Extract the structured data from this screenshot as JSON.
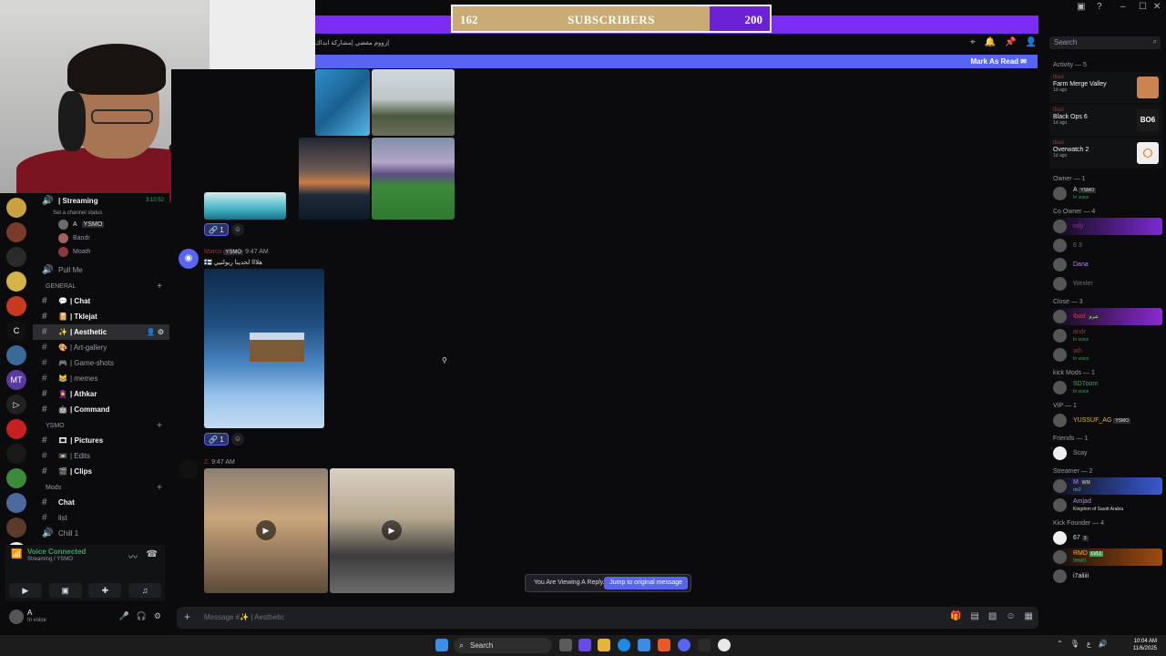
{
  "window": {
    "minimize": "–",
    "maximize": "☐",
    "close": "✕",
    "help": "?"
  },
  "counter": {
    "current": "162",
    "label": "SUBSCRIBERS",
    "goal": "200",
    "progress": 0.81
  },
  "channel_header": {
    "title": "زووم مفضي |مشاركة ايداك|"
  },
  "search": {
    "placeholder": "Search"
  },
  "mark_as_read": {
    "label": "Mark As Read"
  },
  "sidebar": {
    "streaming_title": "| Streaming",
    "streaming_time": "3:10:52",
    "set_status": "Set a channel status",
    "voice_users": [
      {
        "name": "A",
        "tag": "YSMO"
      },
      {
        "name": "Bandr"
      },
      {
        "name": "Moath"
      }
    ],
    "pull_me": "Pull Me",
    "cat_general": "GENERAL",
    "general_channels": [
      {
        "emoji": "💬",
        "name": "| Chat"
      },
      {
        "emoji": "📔",
        "name": "| Tklejat"
      },
      {
        "emoji": "✨",
        "name": "| Aesthetic"
      },
      {
        "emoji": "🎨",
        "name": "| Art-gallery"
      },
      {
        "emoji": "🎮",
        "name": "| Game-shots"
      },
      {
        "emoji": "😹",
        "name": "| memes"
      },
      {
        "emoji": "🧕",
        "name": "| Athkar"
      },
      {
        "emoji": "🤖",
        "name": "| Command"
      }
    ],
    "cat_ysmo": "YSMO",
    "ysmo_channels": [
      {
        "emoji": "🎞",
        "name": "| Pictures"
      },
      {
        "emoji": "📼",
        "name": "| Edits"
      },
      {
        "emoji": "🎬",
        "name": "| Clips"
      }
    ],
    "cat_mods": "Mods",
    "mods_channels": [
      {
        "name": "Chat"
      },
      {
        "name": "list"
      },
      {
        "name": "Chill 1"
      }
    ]
  },
  "voice_panel": {
    "title": "Voice Connected",
    "sub": "Streaming / YSMO"
  },
  "user_panel": {
    "name": "A",
    "status": "In voice"
  },
  "messages": [
    {
      "author": "Marco",
      "tag": "YSMO",
      "time": "9:47 AM",
      "text": "🇫🇮 هلااا لحدينا ريولتيي",
      "reaction": "1"
    },
    {
      "author": "Z.",
      "time": "9:47 AM"
    }
  ],
  "first_reaction": "1",
  "reply_notice": {
    "text": "You Are Viewing A Reply.",
    "button": "Jump to original message"
  },
  "composer": {
    "placeholder": "Message #✨ | Aesthetic"
  },
  "members": {
    "activity_header": "Activity — 5",
    "activities": [
      {
        "user": "Ibad",
        "game": "Farm Merge Valley",
        "ago": "1d ago",
        "color": "#c9844f"
      },
      {
        "user": "Ibad",
        "game": "Black Ops 6",
        "ago": "1d ago",
        "color": "#1b1b1b",
        "logo": "BO6"
      },
      {
        "user": "Ibad",
        "game": "Overwatch 2",
        "ago": "1d ago",
        "color": "#f0f0f0",
        "logo": "⭘"
      }
    ],
    "groups": [
      {
        "header": "Owner — 1",
        "members": [
          {
            "name": "A",
            "tag": "YSMO",
            "sub": "In voice",
            "color": "#dbdee1"
          }
        ]
      },
      {
        "header": "Co Owner — 4",
        "members": [
          {
            "name": "ndy",
            "color": "#8e3a8e",
            "card": "#7a2ad0"
          },
          {
            "name": "6 3",
            "color": "#6d6f78"
          },
          {
            "name": "Dana",
            "color": "#b48af0"
          },
          {
            "name": "Wexler",
            "color": "#6d6f78"
          }
        ]
      },
      {
        "header": "Close — 3",
        "members": [
          {
            "name": "Ibad",
            "tag": "شرم",
            "color": "#e33b3b",
            "card": "#8a2ad0"
          },
          {
            "name": "andr",
            "sub": "In voice",
            "color": "#8e3a3a"
          },
          {
            "name": "ath",
            "sub": "In voice",
            "color": "#8e3a3a"
          }
        ]
      },
      {
        "header": "kick Mods — 1",
        "members": [
          {
            "name": "SD7oom",
            "sub": "In voice",
            "color": "#3ba55c"
          }
        ]
      },
      {
        "header": "VIP — 1",
        "members": [
          {
            "name": "YUSSUF_AG",
            "tag": "YSMO",
            "color": "#f0b232"
          }
        ]
      },
      {
        "header": "Friends — 1",
        "members": [
          {
            "name": "Scay",
            "color": "#949ba4"
          }
        ]
      },
      {
        "header": "Streamer — 2",
        "members": [
          {
            "name": "M",
            "tag": "WM",
            "sub": "rte2",
            "color": "#b48af0",
            "card": "#3a5ad0"
          },
          {
            "name": "Amjad",
            "sub": "Kingdom of Saudi Arabia",
            "color": "#b48af0"
          }
        ]
      },
      {
        "header": "Kick Founder — 4",
        "members": [
          {
            "name": "67",
            "tag": "3",
            "color": "#dbdee1"
          },
          {
            "name": "RMD",
            "tag": "LVL1",
            "sub": "9HMO",
            "color": "#f0b232",
            "card": "#a04a10"
          },
          {
            "name": "i7aliiii",
            "color": "#dbdee1"
          }
        ]
      }
    ]
  },
  "taskbar": {
    "search": "Search",
    "time": "10:04 AM",
    "date": "11/6/2025",
    "lang": "ع"
  }
}
